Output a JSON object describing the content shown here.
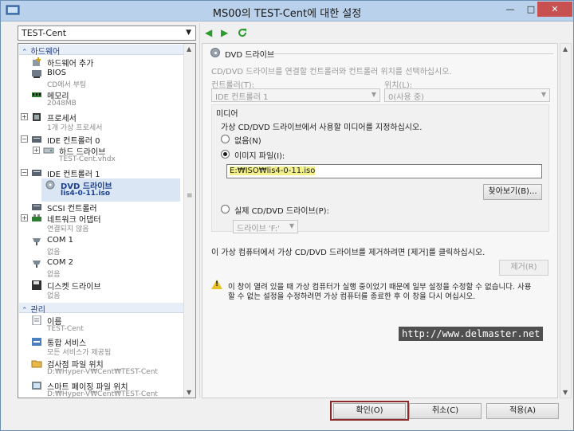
{
  "window": {
    "title": "MS00의 TEST-Cent에 대한 설정",
    "minimize": "—",
    "maximize": "□",
    "close": "✕"
  },
  "vm_selector": {
    "value": "TEST-Cent"
  },
  "tree": {
    "hardware_header": "하드웨어",
    "management_header": "관리",
    "items": {
      "add_hardware": {
        "label": "하드웨어 추가"
      },
      "bios": {
        "label": "BIOS",
        "sub": "CD에서 부팅"
      },
      "memory": {
        "label": "메모리",
        "sub": "2048MB"
      },
      "processor": {
        "label": "프로세서",
        "sub": "1개 가상 프로세서"
      },
      "ide0": {
        "label": "IDE 컨트롤러 0"
      },
      "hard_drive": {
        "label": "하드 드라이브",
        "sub": "TEST-Cent.vhdx"
      },
      "ide1": {
        "label": "IDE 컨트롤러 1"
      },
      "dvd": {
        "label": "DVD 드라이브",
        "sub": "lis4-0-11.iso"
      },
      "scsi": {
        "label": "SCSI 컨트롤러"
      },
      "network": {
        "label": "네트워크 어댑터",
        "sub": "연결되지 않음"
      },
      "com1": {
        "label": "COM 1",
        "sub": "없음"
      },
      "com2": {
        "label": "COM 2",
        "sub": "없음"
      },
      "diskette": {
        "label": "디스켓 드라이브",
        "sub": "없음"
      },
      "name": {
        "label": "이름",
        "sub": "TEST-Cent"
      },
      "integration": {
        "label": "통합 서비스",
        "sub": "모든 서비스가 제공됨"
      },
      "checkpoint": {
        "label": "검사점 파일 위치",
        "sub": "D:₩Hyper-V₩Cent₩TEST-Cent"
      },
      "smart_paging": {
        "label": "스마트 페이징 파일 위치",
        "sub": "D:₩Hyper-V₩Cent₩TEST-Cent"
      }
    }
  },
  "panel": {
    "header": "DVD 드라이브",
    "description": "CD/DVD 드라이브를 연결할 컨트롤러와 컨트롤러 위치를 선택하십시오.",
    "controller_label": "컨트롤러(T):",
    "controller_value": "IDE 컨트롤러 1",
    "location_label": "위치(L):",
    "location_value": "0(사용 중)",
    "media_label": "미디어",
    "media_desc": "가상 CD/DVD 드라이브에서 사용할 미디어를 지정하십시오.",
    "none_option": "없음(N)",
    "image_option": "이미지 파일(I):",
    "image_path": "E:₩ISO₩lis4-0-11.iso",
    "browse_button": "찾아보기(B)...",
    "physical_option": "실제 CD/DVD 드라이브(P):",
    "physical_value": "드라이브 'F:'",
    "remove_hint": "이 가상 컴퓨터에서 가상 CD/DVD 드라이브를 제거하려면 [제거]를 클릭하십시오.",
    "remove_button": "제거(R)",
    "warning_line1": "이 창이 열려 있을 때 가상 컴퓨터가 실행 중이었기 때문에 일부 설정을 수정할 수 없습니다. 사용",
    "warning_line2": "할 수 없는 설정을 수정하려면 가상 컴퓨터를 종료한 후 이 창을 다시 여십시오."
  },
  "watermark": "http://www.delmaster.net",
  "footer": {
    "ok": "확인(O)",
    "cancel": "취소(C)",
    "apply": "적용(A)"
  },
  "colors": {
    "titlebar": "#b9d1ea",
    "selected": "#dbe6f4",
    "accent_green": "#2d9a2d",
    "ok_highlight": "#8b2a2a"
  }
}
